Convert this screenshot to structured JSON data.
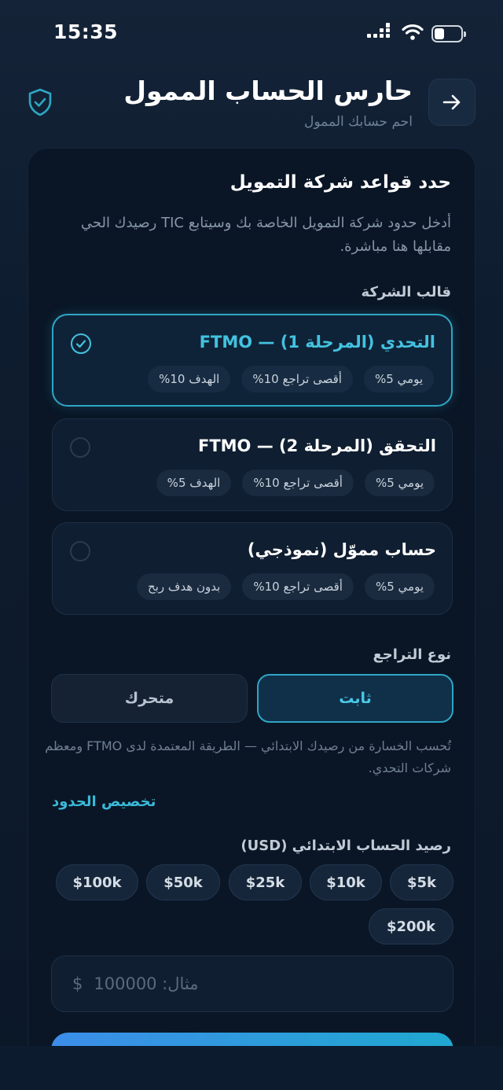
{
  "status_bar": {
    "time": "15:35"
  },
  "header": {
    "title": "حارس الحساب الممول",
    "subtitle": "احم حسابك الممول",
    "back_icon": "arrow-right-icon",
    "shield_icon": "shield-check-icon"
  },
  "card": {
    "title": "حدد قواعد شركة التمويل",
    "description": "أدخل حدود شركة التمويل الخاصة بك وسيتابع TIC رصيدك الحي مقابلها هنا مباشرة.",
    "template_label": "قالب الشركة",
    "templates": [
      {
        "name": "التحدي (المرحلة 1) — FTMO",
        "selected": true,
        "chips": [
          "يومي 5%",
          "أقصى تراجع 10%",
          "الهدف 10%"
        ]
      },
      {
        "name": "التحقق (المرحلة 2) — FTMO",
        "selected": false,
        "chips": [
          "يومي 5%",
          "أقصى تراجع 10%",
          "الهدف 5%"
        ]
      },
      {
        "name": "حساب مموّل (نموذجي)",
        "selected": false,
        "chips": [
          "يومي 5%",
          "أقصى تراجع 10%",
          "بدون هدف ربح"
        ]
      }
    ],
    "drawdown_label": "نوع التراجع",
    "drawdown_options": {
      "static": "ثابت",
      "trailing": "متحرك"
    },
    "drawdown_selected": "static",
    "drawdown_description": "تُحسب الخسارة من رصيدك الابتدائي — الطريقة المعتمدة لدى FTMO ومعظم شركات التحدي.",
    "customize_link": "تخصيص الحدود",
    "balance_label": "رصيد الحساب الابتدائي (USD)",
    "balances": [
      "$5k",
      "$10k",
      "$25k",
      "$50k",
      "$100k",
      "$200k"
    ],
    "amount_input": {
      "currency": "$",
      "placeholder": "مثال: 100000"
    }
  },
  "colors": {
    "accent": "#2fa6c4",
    "background": "#0d1b2e",
    "cta_start": "#3c8ee8",
    "cta_end": "#20a8d0"
  }
}
